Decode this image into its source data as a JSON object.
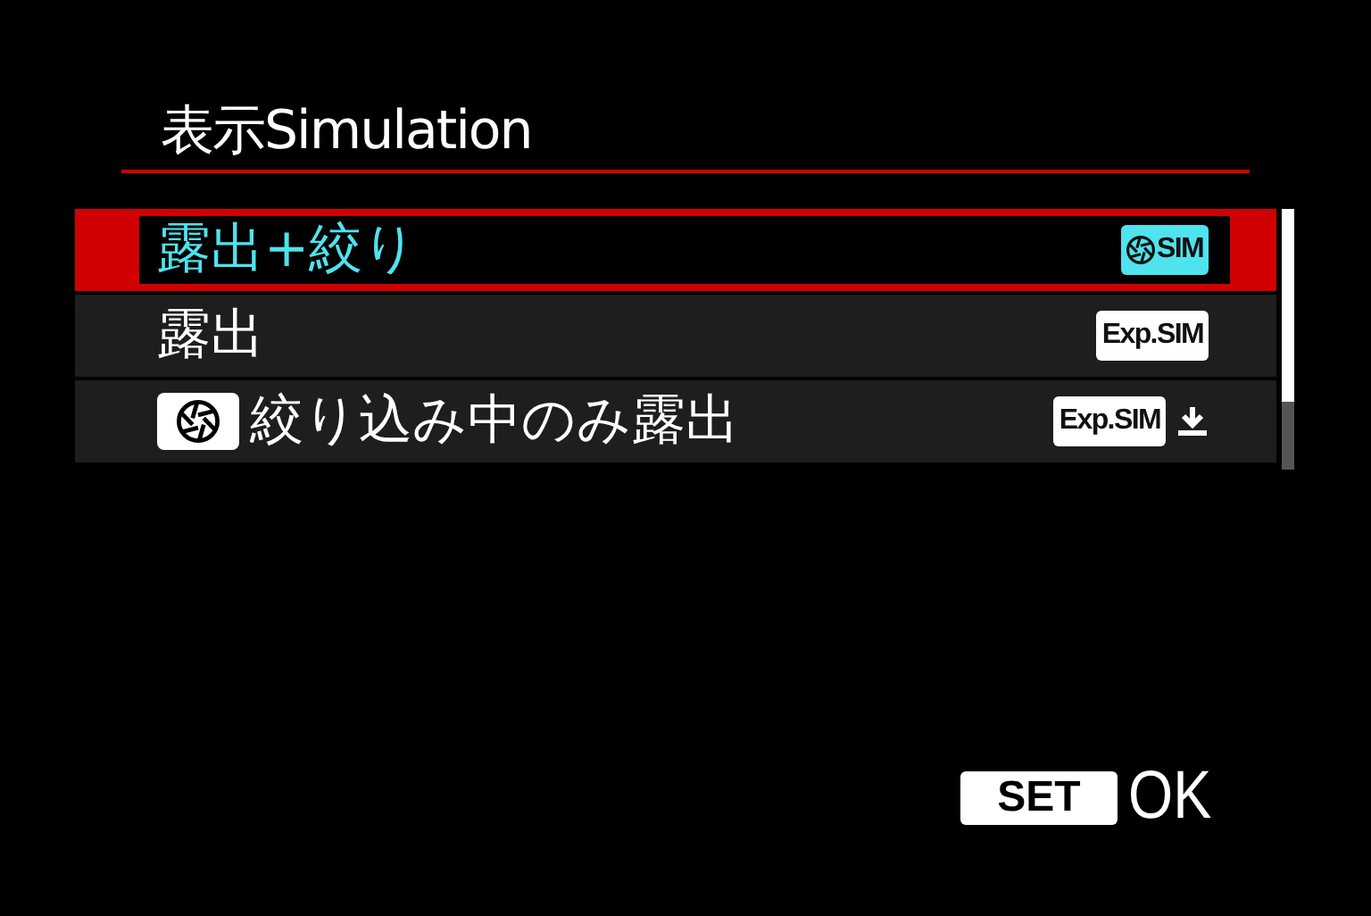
{
  "title": "表示Simulation",
  "items": [
    {
      "label": "露出+絞り",
      "selected": true,
      "lead_icon": false,
      "badge": {
        "kind": "aperture",
        "text": "SIM"
      },
      "download": false
    },
    {
      "label": "露出",
      "selected": false,
      "lead_icon": false,
      "badge": {
        "kind": "text",
        "text": "Exp.SIM"
      },
      "download": false
    },
    {
      "label": "絞り込み中のみ露出",
      "selected": false,
      "lead_icon": true,
      "badge": {
        "kind": "text",
        "text": "Exp.SIM"
      },
      "download": true
    }
  ],
  "footer": {
    "key": "SET",
    "action": "OK"
  }
}
